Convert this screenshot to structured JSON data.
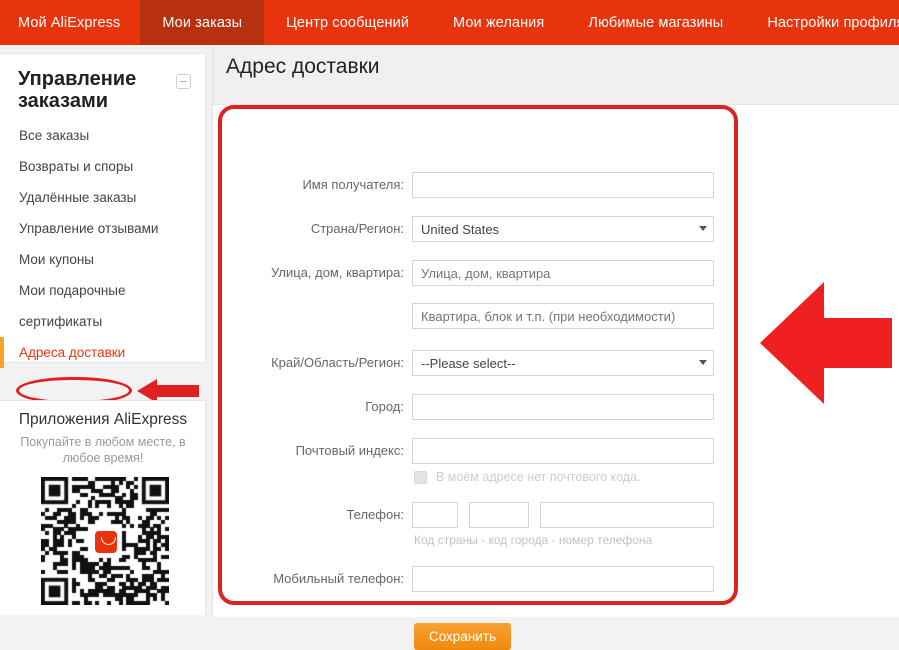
{
  "topnav": {
    "items": [
      {
        "label": "Мой AliExpress",
        "active": false
      },
      {
        "label": "Мои заказы",
        "active": true
      },
      {
        "label": "Центр сообщений",
        "active": false
      },
      {
        "label": "Мои желания",
        "active": false
      },
      {
        "label": "Любимые магазины",
        "active": false
      },
      {
        "label": "Настройки профиля",
        "active": false
      }
    ],
    "bar_color": "#e8340c",
    "active_color": "#b8310e"
  },
  "sidebar": {
    "title": "Управление заказами",
    "collapse_icon": "minus-circle-icon",
    "items": [
      {
        "label": "Все заказы",
        "active": false
      },
      {
        "label": "Возвраты и споры",
        "active": false
      },
      {
        "label": "Удалённые заказы",
        "active": false
      },
      {
        "label": "Управление отзывами",
        "active": false
      },
      {
        "label": "Мои купоны",
        "active": false
      },
      {
        "label": "Мои подарочные",
        "active": false
      },
      {
        "label": "сертификаты",
        "active": false
      },
      {
        "label": "Адреса доставки",
        "active": true
      }
    ],
    "active_accent": "#f7a32a",
    "active_text_color": "#e8340c",
    "apps": {
      "title": "Приложения AliExpress",
      "subtitle": "Покупайте в любом месте, в любое время!",
      "qr_icon": "qr-code-icon",
      "logo_icon": "aliexpress-logo-icon"
    }
  },
  "content": {
    "page_title": "Адрес доставки",
    "form": {
      "fields": [
        {
          "label": "Имя получателя:",
          "type": "text",
          "value": "",
          "placeholder": ""
        },
        {
          "label": "Страна/Регион:",
          "type": "select",
          "value": "United States",
          "placeholder": ""
        },
        {
          "label": "Улица, дом, квартира:",
          "type": "text",
          "value": "",
          "placeholder": "Улица, дом, квартира"
        },
        {
          "label": "",
          "type": "text",
          "value": "",
          "placeholder": "Квартира, блок и т.п. (при необходимости)"
        },
        {
          "label": "Край/Область/Регион:",
          "type": "select",
          "value": "--Please select--",
          "placeholder": ""
        },
        {
          "label": "Город:",
          "type": "text",
          "value": "",
          "placeholder": ""
        },
        {
          "label": "Почтовый индекс:",
          "type": "text",
          "value": "",
          "placeholder": ""
        },
        {
          "label": "Телефон:",
          "type": "phone",
          "value": "",
          "placeholder": ""
        },
        {
          "label": "Мобильный телефон:",
          "type": "text",
          "value": "",
          "placeholder": ""
        }
      ],
      "no_postcode_checkbox_label": "В моём адресе нет почтового кода.",
      "phone_hint": "Код страны - код города - номер телефона",
      "save_label": "Сохранить",
      "save_color": "#f7941d"
    }
  },
  "annotations": {
    "highlight_color": "#de2222",
    "form_highlight_icon": "red-rounded-rectangle-highlight",
    "sidebar_highlight_icon": "red-ellipse-highlight",
    "big_arrow_icon": "left-arrow-icon",
    "small_arrow_icon": "left-arrow-icon"
  }
}
